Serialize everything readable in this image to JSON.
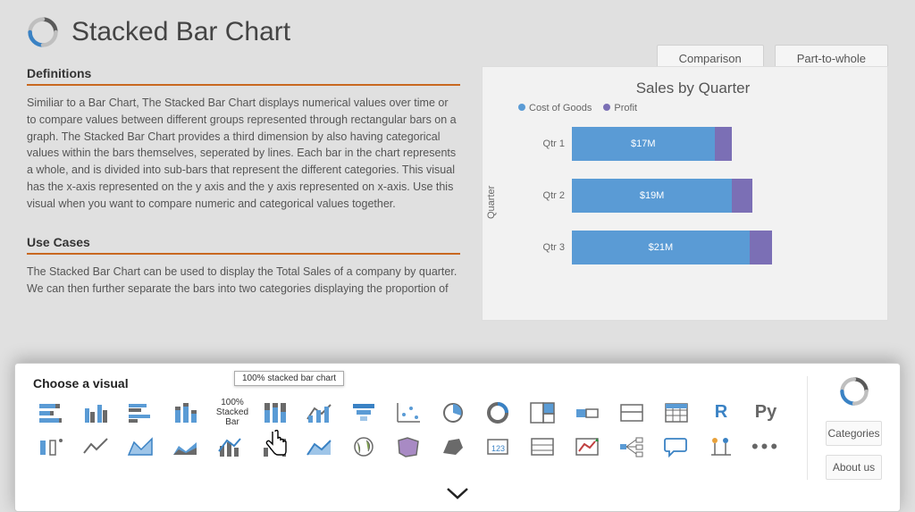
{
  "header": {
    "title": "Stacked Bar Chart"
  },
  "top_buttons": {
    "comparison": "Comparison",
    "part_to_whole": "Part-to-whole"
  },
  "sections": {
    "definitions_title": "Definitions",
    "definitions_body": "Similiar to a Bar Chart, The Stacked Bar Chart displays numerical values over time or to compare values between different groups represented through rectangular bars on a graph. The Stacked Bar Chart provides a third dimension by also having categorical values within the bars themselves, seperated by lines. Each bar in the chart represents a whole, and is divided into sub-bars that represent the different categories. This visual has the x-axis represented on the y axis and the y axis represented on x-axis. Use this visual when you want to compare numeric and categorical values together.",
    "usecases_title": "Use Cases",
    "usecases_body": "The Stacked Bar Chart can be used to display the Total Sales of a company by quarter. We can then further separate the bars into two categories displaying the proportion of"
  },
  "chart_data": {
    "type": "bar",
    "orientation": "horizontal",
    "title": "Sales by Quarter",
    "ylabel": "Quarter",
    "categories": [
      "Qtr 1",
      "Qtr 2",
      "Qtr 3"
    ],
    "series": [
      {
        "name": "Cost of Goods",
        "color": "#5a9bd5",
        "values": [
          17,
          19,
          21
        ]
      },
      {
        "name": "Profit",
        "color": "#7b6fb5",
        "values": [
          2,
          2.2,
          2.4
        ]
      }
    ],
    "value_labels": [
      "$17M",
      "$19M",
      "$21M"
    ],
    "xlim": [
      0,
      30
    ]
  },
  "legend_prefixes": {
    "cost": "Cost of Goods",
    "profit": "Profit"
  },
  "visual_picker": {
    "title": "Choose a visual",
    "tooltip": "100% stacked bar chart",
    "selected_label": "100% Stacked Bar",
    "r_label": "R",
    "py_label": "Py",
    "more": "• • •"
  },
  "side_panel": {
    "categories": "Categories",
    "about": "About us"
  }
}
